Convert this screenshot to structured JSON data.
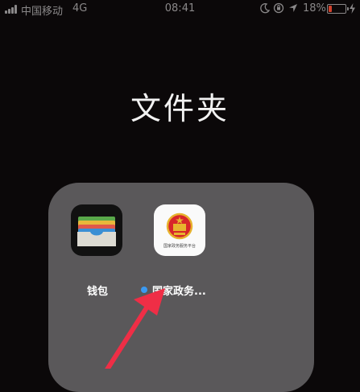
{
  "status_bar": {
    "carrier": "中国移动",
    "network": "4G",
    "time": "08:41",
    "battery_percent": "18%",
    "icons": [
      "signal-icon",
      "moon-icon",
      "orientation-lock-icon",
      "location-icon",
      "battery-icon",
      "charging-icon"
    ]
  },
  "folder": {
    "title": "文件夹",
    "apps": [
      {
        "label": "钱包",
        "icon": "wallet-icon"
      },
      {
        "label": "国家政务...",
        "icon": "gov-emblem-icon",
        "icon_text": "国家政务服务平台",
        "new_dot_color": "#3a9af2"
      }
    ]
  },
  "annotation": {
    "arrow_color": "#ef2e46"
  }
}
